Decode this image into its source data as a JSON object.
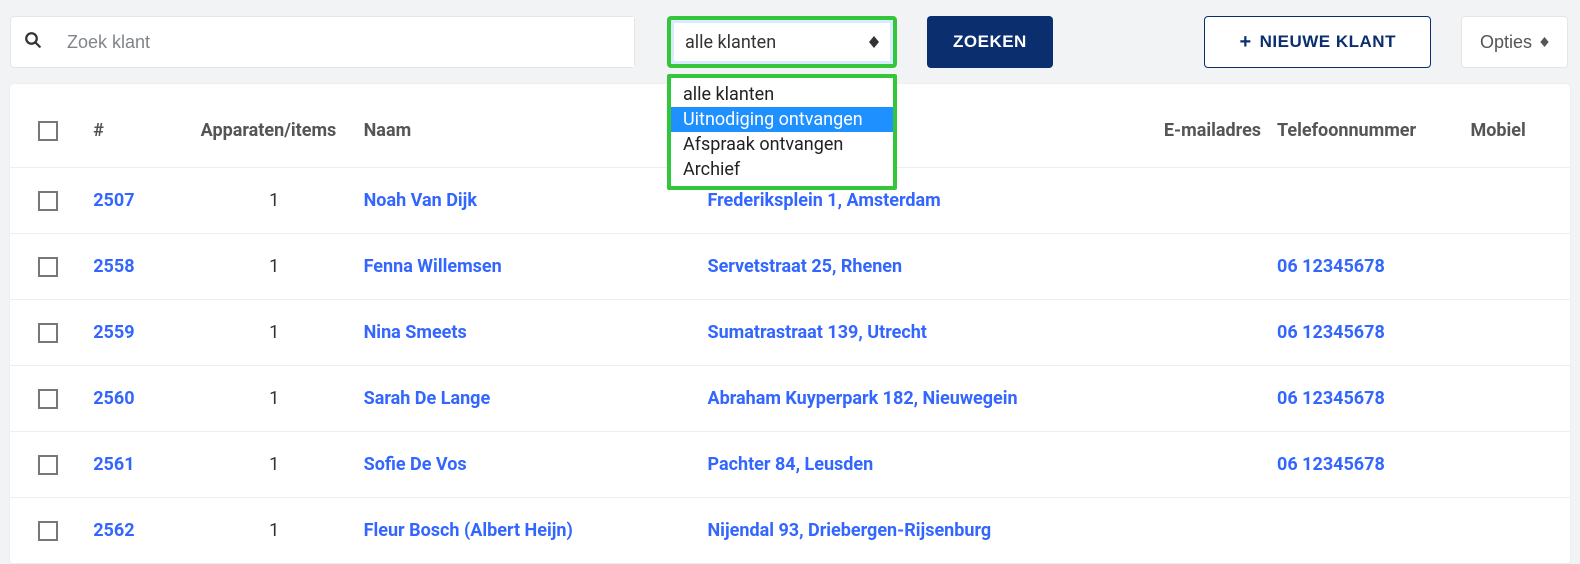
{
  "toolbar": {
    "search_placeholder": "Zoek klant",
    "filter_selected": "alle klanten",
    "filter_options": [
      {
        "label": "alle klanten",
        "selected": false
      },
      {
        "label": "Uitnodiging ontvangen",
        "selected": true
      },
      {
        "label": "Afspraak ontvangen",
        "selected": false
      },
      {
        "label": "Archief",
        "selected": false
      }
    ],
    "search_button": "ZOEKEN",
    "new_button": "NIEUWE KLANT",
    "options_button": "Opties"
  },
  "table": {
    "headers": {
      "id": "#",
      "devices": "Apparaten/items",
      "name": "Naam",
      "email": "E-mailadres",
      "phone": "Telefoonnummer",
      "mobile": "Mobiel"
    },
    "rows": [
      {
        "id": "2507",
        "devices": "1",
        "name": "Noah Van Dijk",
        "address": "Frederiksplein 1, Amsterdam",
        "email": "",
        "phone": "",
        "mobile": ""
      },
      {
        "id": "2558",
        "devices": "1",
        "name": "Fenna Willemsen",
        "address": "Servetstraat 25, Rhenen",
        "email": "",
        "phone": "06 12345678",
        "mobile": ""
      },
      {
        "id": "2559",
        "devices": "1",
        "name": "Nina Smeets",
        "address": "Sumatrastraat 139, Utrecht",
        "email": "",
        "phone": "06 12345678",
        "mobile": ""
      },
      {
        "id": "2560",
        "devices": "1",
        "name": "Sarah De Lange",
        "address": "Abraham Kuyperpark 182, Nieuwegein",
        "email": "",
        "phone": "06 12345678",
        "mobile": ""
      },
      {
        "id": "2561",
        "devices": "1",
        "name": "Sofie De Vos",
        "address": "Pachter 84, Leusden",
        "email": "",
        "phone": "06 12345678",
        "mobile": ""
      },
      {
        "id": "2562",
        "devices": "1",
        "name": "Fleur Bosch (Albert Heijn)",
        "address": "Nijendal 93, Driebergen-Rijsenburg",
        "email": "",
        "phone": "",
        "mobile": ""
      }
    ]
  }
}
